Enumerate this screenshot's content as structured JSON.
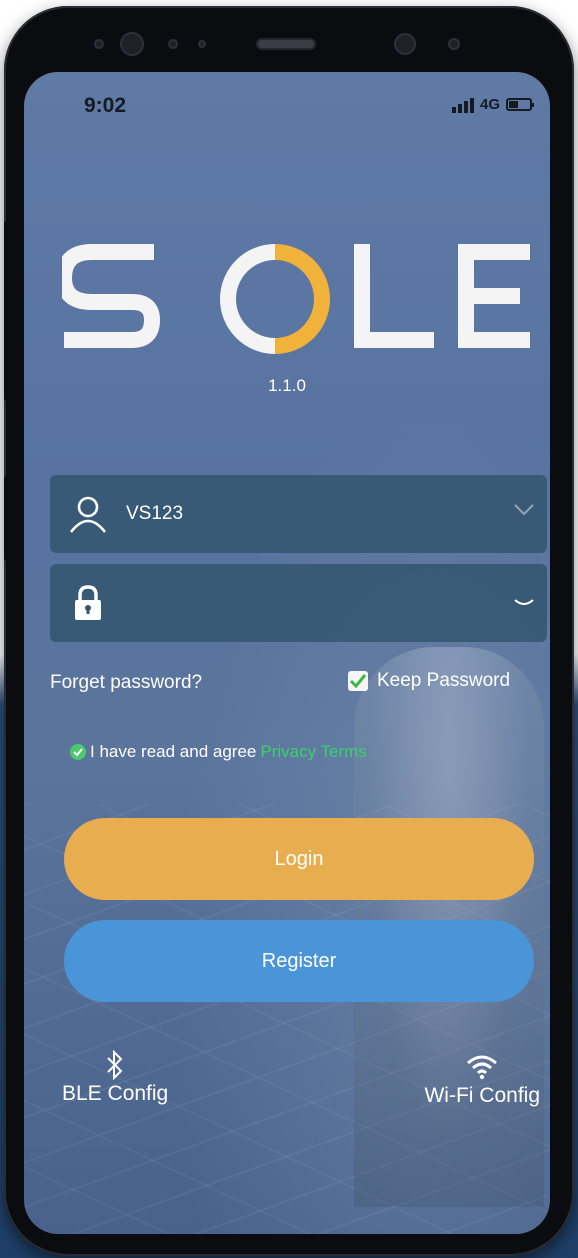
{
  "status_bar": {
    "time": "9:02",
    "network": "4G",
    "signal_icon": "signal-bars-icon",
    "battery_icon": "battery-icon"
  },
  "brand": {
    "logo_text": "SOLE",
    "logo_accent_color": "#f0b23a",
    "version": "1.1.0"
  },
  "login_form": {
    "username_value": "VS123",
    "username_icon": "user-icon",
    "password_value": "",
    "password_icon": "lock-icon",
    "forget_password_label": "Forget password?",
    "keep_password_label": "Keep Password",
    "keep_password_checked": true
  },
  "agreement": {
    "text": "I have read and agree",
    "link_text": "Privacy Terms",
    "checked": true,
    "link_color": "#38d26a"
  },
  "buttons": {
    "login_label": "Login",
    "login_color": "#e8ad4e",
    "register_label": "Register",
    "register_color": "#4a95d7"
  },
  "config": {
    "ble_label": "BLE Config",
    "ble_icon": "bluetooth-icon",
    "wifi_label": "Wi-Fi Config",
    "wifi_icon": "wifi-icon"
  }
}
